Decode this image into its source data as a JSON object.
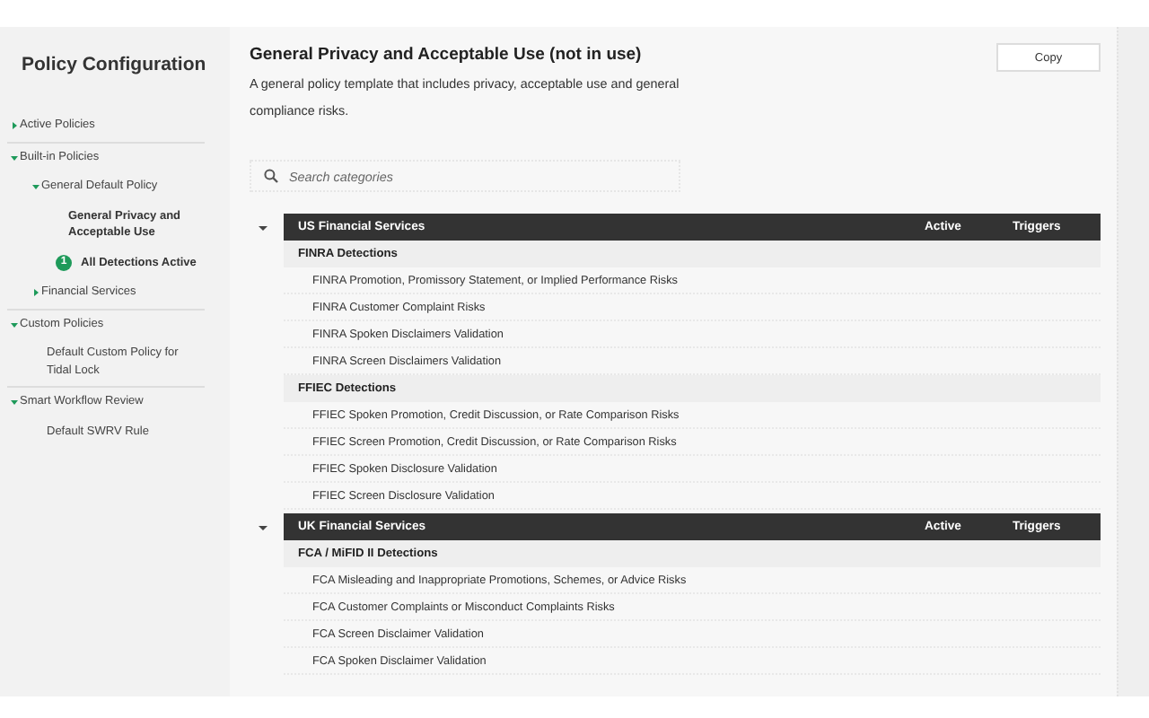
{
  "sidebar": {
    "title": "Policy Configuration",
    "items": [
      {
        "label": "Active Policies",
        "expanded": false,
        "selected": false
      },
      {
        "label": "Built-in Policies",
        "expanded": true,
        "selected": false,
        "children": [
          {
            "label": "General Default Policy",
            "expanded": true,
            "selected": false,
            "children": [
              {
                "label": "General Privacy and Acceptable Use",
                "selected": true
              },
              {
                "label": "All Detections Active",
                "kind": "badge",
                "badge": "1",
                "selected": false
              }
            ]
          },
          {
            "label": "Financial Services",
            "expanded": false,
            "selected": false
          }
        ]
      },
      {
        "label": "Custom Policies",
        "expanded": true,
        "selected": false,
        "children": [
          {
            "label": "Default Custom Policy for Tidal Lock",
            "selected": false
          }
        ]
      },
      {
        "label": "Smart Workflow Review",
        "expanded": true,
        "selected": false,
        "children": [
          {
            "label": "Default SWRV Rule",
            "selected": false
          }
        ]
      }
    ]
  },
  "policy": {
    "title": "General Privacy and Acceptable Use (not in use)",
    "description": "A general policy template that includes privacy, acceptable use and general compliance risks.",
    "copy_button": "Copy"
  },
  "search": {
    "placeholder": "Search categories"
  },
  "sections": [
    {
      "name": "US Financial Services",
      "expanded": true,
      "columns": [
        "Active",
        "Triggers"
      ],
      "groups": [
        {
          "name": "FINRA Detections",
          "rules": [
            "FINRA Promotion, Promissory Statement, or Implied Performance Risks",
            "FINRA Customer Complaint Risks",
            "FINRA Spoken Disclaimers Validation",
            "FINRA Screen Disclaimers Validation"
          ]
        },
        {
          "name": "FFIEC Detections",
          "rules": [
            "FFIEC Spoken Promotion, Credit Discussion, or Rate Comparison Risks",
            "FFIEC Screen Promotion, Credit Discussion, or Rate Comparison Risks",
            "FFIEC Spoken Disclosure Validation",
            "FFIEC Screen Disclosure Validation"
          ]
        }
      ]
    },
    {
      "name": "UK Financial Services",
      "expanded": true,
      "columns": [
        "Active",
        "Triggers"
      ],
      "groups": [
        {
          "name": "FCA / MiFID II Detections",
          "rules": [
            "FCA Misleading and Inappropriate Promotions, Schemes, or Advice Risks",
            "FCA Customer Complaints or Misconduct Complaints Risks",
            "FCA Screen Disclaimer Validation",
            "FCA Spoken Disclaimer Validation"
          ]
        }
      ]
    }
  ]
}
